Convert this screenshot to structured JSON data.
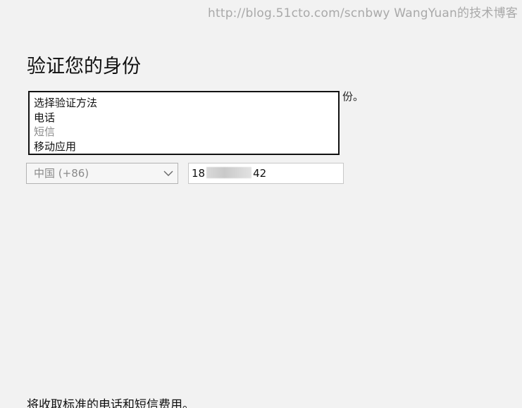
{
  "watermark": "http://blog.51cto.com/scnbwy WangYuan的技术博客",
  "title": "验证您的身份",
  "instruction_visible": "份。",
  "verification_methods": {
    "options": [
      "选择验证方法",
      "电话",
      "短信",
      "移动应用"
    ]
  },
  "phone": {
    "country_value": "中国 (+86)",
    "number_prefix": "18",
    "number_suffix": "42"
  },
  "footer_note": "将收取标准的电话和短信费用。"
}
